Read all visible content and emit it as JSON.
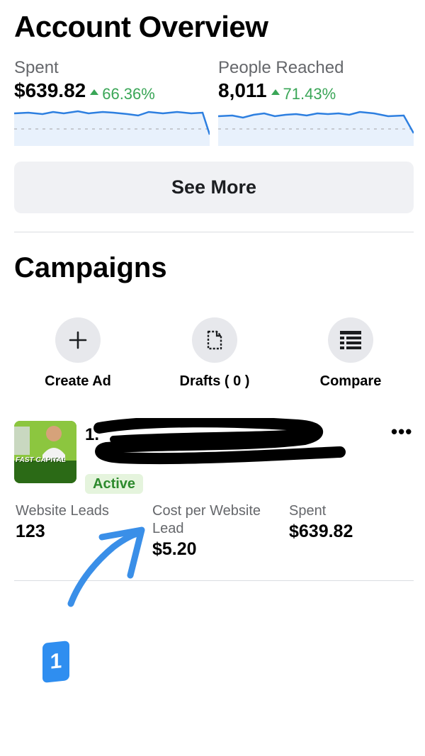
{
  "header": {
    "title": "Account Overview"
  },
  "metrics": {
    "spent": {
      "label": "Spent",
      "value": "$639.82",
      "change": "66.36%"
    },
    "reach": {
      "label": "People Reached",
      "value": "8,011",
      "change": "71.43%"
    }
  },
  "see_more_label": "See More",
  "campaigns": {
    "title": "Campaigns",
    "actions": [
      {
        "label": "Create Ad",
        "icon": "plus-icon"
      },
      {
        "label": "Drafts ( 0 )",
        "icon": "document-icon"
      },
      {
        "label": "Compare",
        "icon": "table-icon"
      }
    ],
    "item": {
      "name_prefix": "1.",
      "thumbnail_text": "FAST CAPITAL",
      "status": "Active",
      "stats": [
        {
          "label": "Website Leads",
          "value": "123"
        },
        {
          "label": "Cost per Website Lead",
          "value": "$5.20"
        },
        {
          "label": "Spent",
          "value": "$639.82"
        }
      ]
    }
  },
  "annotation": {
    "step": "1"
  },
  "colors": {
    "positive": "#3aa657",
    "accent_blue": "#2f8ef0",
    "chart_line": "#2d7fe0"
  }
}
